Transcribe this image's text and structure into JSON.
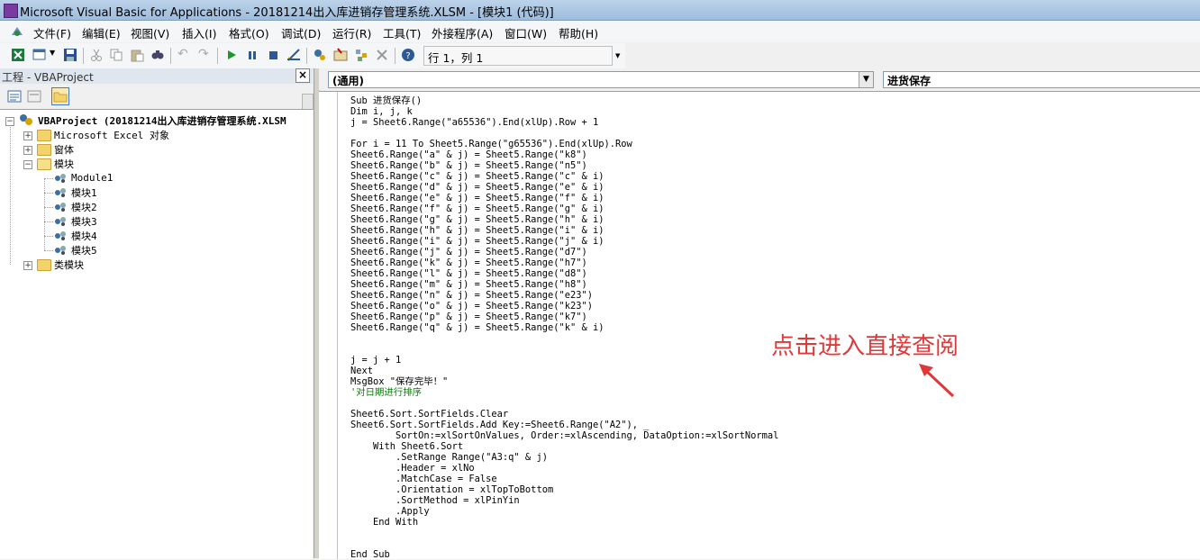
{
  "window": {
    "title": "Microsoft Visual Basic for Applications - 20181214出入库进销存管理系统.XLSM - [模块1 (代码)]"
  },
  "menu": [
    "文件(F)",
    "编辑(E)",
    "视图(V)",
    "插入(I)",
    "格式(O)",
    "调试(D)",
    "运行(R)",
    "工具(T)",
    "外接程序(A)",
    "窗口(W)",
    "帮助(H)"
  ],
  "toolbar": {
    "position": "行 1，列 1",
    "icons": [
      "excel-icon",
      "insert-userform-icon",
      "save-icon",
      "cut-icon",
      "copy-icon",
      "paste-icon",
      "find-icon",
      "undo-icon",
      "redo-icon",
      "run-icon",
      "break-icon",
      "reset-icon",
      "design-mode-icon",
      "project-explorer-icon",
      "properties-icon",
      "object-browser-icon",
      "toolbox-icon",
      "help-icon"
    ]
  },
  "project_pane": {
    "title": "工程 - VBAProject",
    "close": "×",
    "root": "VBAProject (20181214出入库进销存管理系统.XLSM",
    "folders": {
      "excel_objects": "Microsoft Excel 对象",
      "forms": "窗体",
      "modules": "模块",
      "class_modules": "类模块"
    },
    "modules": [
      "Module1",
      "模块1",
      "模块2",
      "模块3",
      "模块4",
      "模块5"
    ]
  },
  "code_window": {
    "object_combo": "(通用)",
    "procedure_combo": "进货保存",
    "lines": [
      "Sub 进货保存()",
      "Dim i, j, k",
      "j = Sheet6.Range(\"a65536\").End(xlUp).Row + 1",
      "",
      "For i = 11 To Sheet5.Range(\"g65536\").End(xlUp).Row",
      "Sheet6.Range(\"a\" & j) = Sheet5.Range(\"k8\")",
      "Sheet6.Range(\"b\" & j) = Sheet5.Range(\"n5\")",
      "Sheet6.Range(\"c\" & j) = Sheet5.Range(\"c\" & i)",
      "Sheet6.Range(\"d\" & j) = Sheet5.Range(\"e\" & i)",
      "Sheet6.Range(\"e\" & j) = Sheet5.Range(\"f\" & i)",
      "Sheet6.Range(\"f\" & j) = Sheet5.Range(\"g\" & i)",
      "Sheet6.Range(\"g\" & j) = Sheet5.Range(\"h\" & i)",
      "Sheet6.Range(\"h\" & j) = Sheet5.Range(\"i\" & i)",
      "Sheet6.Range(\"i\" & j) = Sheet5.Range(\"j\" & i)",
      "Sheet6.Range(\"j\" & j) = Sheet5.Range(\"d7\")",
      "Sheet6.Range(\"k\" & j) = Sheet5.Range(\"h7\")",
      "Sheet6.Range(\"l\" & j) = Sheet5.Range(\"d8\")",
      "Sheet6.Range(\"m\" & j) = Sheet5.Range(\"h8\")",
      "Sheet6.Range(\"n\" & j) = Sheet5.Range(\"e23\")",
      "Sheet6.Range(\"o\" & j) = Sheet5.Range(\"k23\")",
      "Sheet6.Range(\"p\" & j) = Sheet5.Range(\"k7\")",
      "Sheet6.Range(\"q\" & j) = Sheet5.Range(\"k\" & i)",
      "",
      "",
      "j = j + 1",
      "Next",
      "MsgBox \"保存完毕！\"",
      "'对日期进行排序",
      "",
      "Sheet6.Sort.SortFields.Clear",
      "Sheet6.Sort.SortFields.Add Key:=Sheet6.Range(\"A2\"), _",
      "        SortOn:=xlSortOnValues, Order:=xlAscending, DataOption:=xlSortNormal",
      "    With Sheet6.Sort",
      "        .SetRange Range(\"A3:q\" & j)",
      "        .Header = xlNo",
      "        .MatchCase = False",
      "        .Orientation = xlTopToBottom",
      "        .SortMethod = xlPinYin",
      "        .Apply",
      "    End With",
      "",
      "",
      "End Sub"
    ]
  },
  "annotation": {
    "text": "点击进入直接查阅",
    "color": "#e03838"
  }
}
